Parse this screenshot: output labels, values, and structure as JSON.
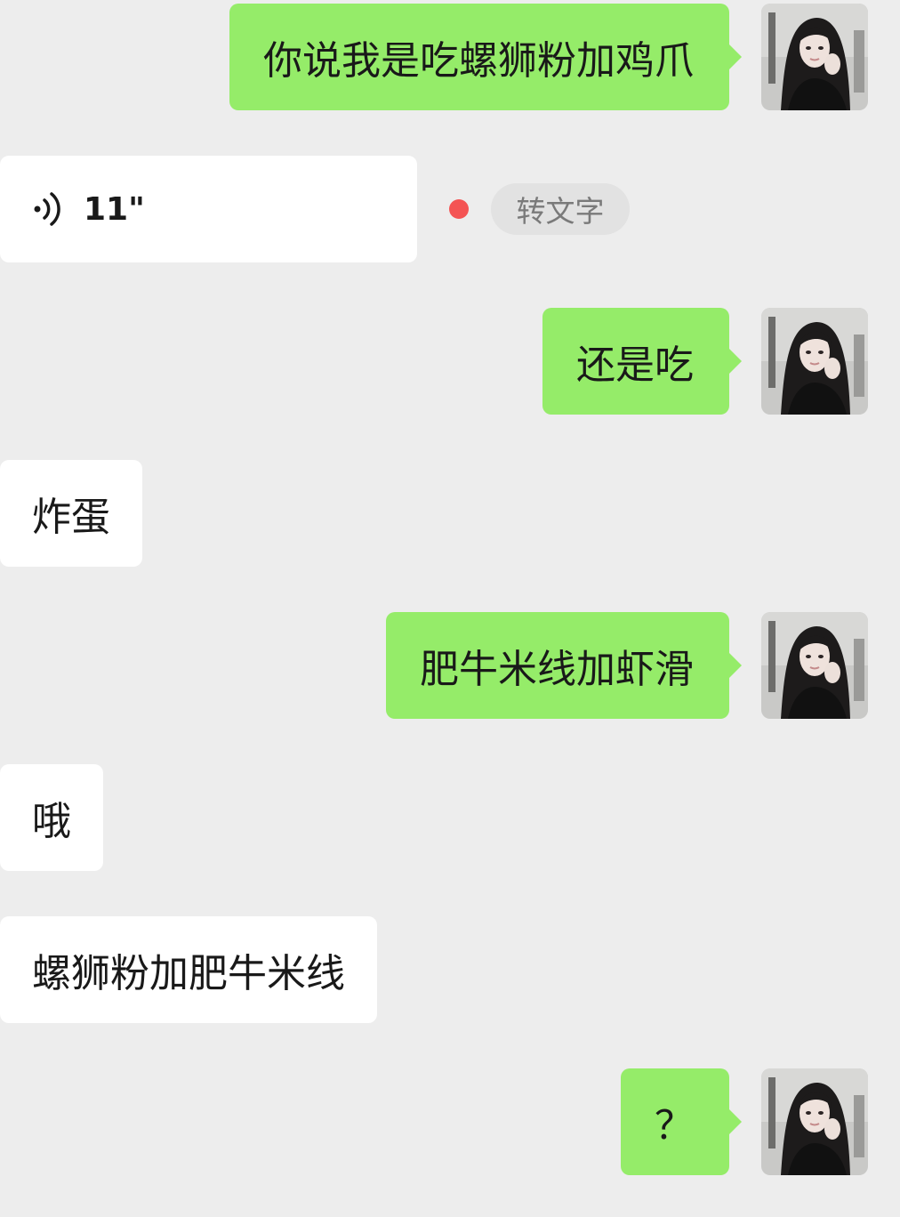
{
  "messages": [
    {
      "direction": "out",
      "type": "text",
      "text": "你说我是吃螺狮粉加鸡爪"
    },
    {
      "direction": "in",
      "type": "voice",
      "duration": "11\"",
      "unread": true,
      "convert_label": "转文字"
    },
    {
      "direction": "out",
      "type": "text",
      "text": "还是吃"
    },
    {
      "direction": "in",
      "type": "text",
      "text": "炸蛋"
    },
    {
      "direction": "out",
      "type": "text",
      "text": "肥牛米线加虾滑"
    },
    {
      "direction": "in",
      "type": "text",
      "text": "哦"
    },
    {
      "direction": "in",
      "type": "text",
      "text": "螺狮粉加肥牛米线"
    },
    {
      "direction": "out",
      "type": "text",
      "text": "？"
    }
  ],
  "colors": {
    "background": "#ededed",
    "outgoing_bubble": "#95ec69",
    "incoming_bubble": "#ffffff",
    "unread_dot": "#f45454"
  },
  "icons": {
    "voice": "voice-wave-icon",
    "avatar": "user-avatar-photo"
  }
}
